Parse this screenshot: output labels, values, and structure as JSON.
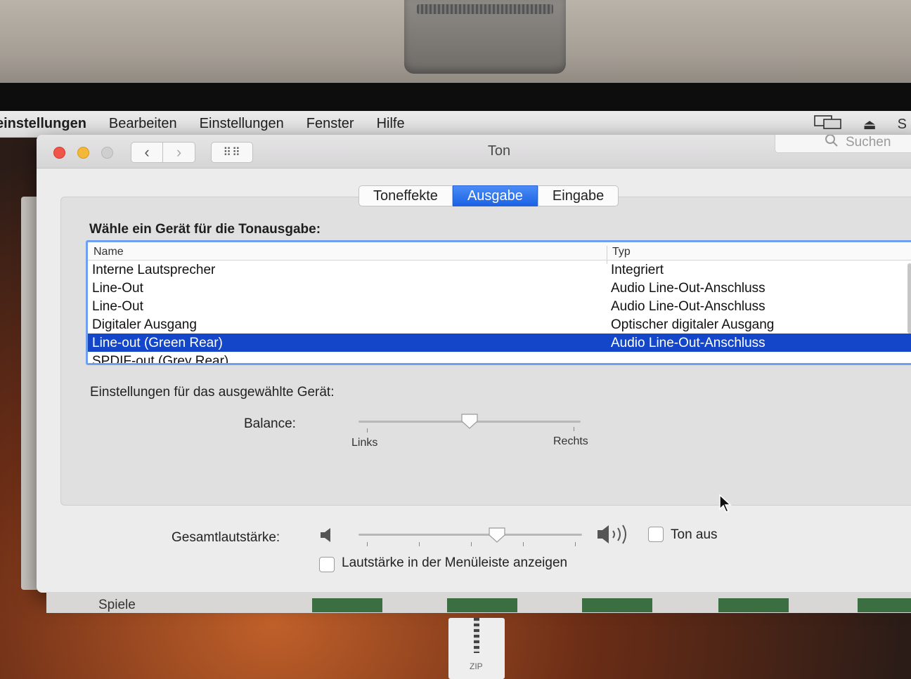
{
  "menubar": {
    "app": "einstellungen",
    "items": [
      "Bearbeiten",
      "Einstellungen",
      "Fenster",
      "Hilfe"
    ],
    "right_item": "S"
  },
  "window": {
    "title": "Ton",
    "search_placeholder": "Suchen"
  },
  "tabs": [
    {
      "label": "Toneffekte",
      "selected": false
    },
    {
      "label": "Ausgabe",
      "selected": true
    },
    {
      "label": "Eingabe",
      "selected": false
    }
  ],
  "output": {
    "heading": "Wähle ein Gerät für die Tonausgabe:",
    "columns": [
      "Name",
      "Typ"
    ],
    "devices": [
      {
        "name": "Interne Lautsprecher",
        "type": "Integriert"
      },
      {
        "name": "Line-Out",
        "type": "Audio Line-Out-Anschluss"
      },
      {
        "name": "Line-Out",
        "type": "Audio Line-Out-Anschluss"
      },
      {
        "name": "Digitaler Ausgang",
        "type": "Optischer digitaler Ausgang"
      },
      {
        "name": "Line-out (Green Rear)",
        "type": "Audio Line-Out-Anschluss"
      },
      {
        "name": "SPDIF-out (Grey Rear)",
        "type": ""
      }
    ],
    "selected_index": 4,
    "settings_heading": "Einstellungen für das ausgewählte Gerät:",
    "balance": {
      "label": "Balance:",
      "left_label": "Links",
      "right_label": "Rechts",
      "value": 0.5
    }
  },
  "volume": {
    "label": "Gesamtlautstärke:",
    "value": 0.62,
    "mute_label": "Ton aus",
    "mute_checked": false,
    "menubar_label": "Lautstärke in der Menüleiste anzeigen",
    "menubar_checked": false
  },
  "desktop": {
    "finder_item": "Spiele",
    "zip_label": "ZIP"
  },
  "colors": {
    "selection": "#1346c9",
    "tab_selected": "#1c62e3",
    "close": "#f0554a",
    "minimize": "#f3b83a"
  }
}
